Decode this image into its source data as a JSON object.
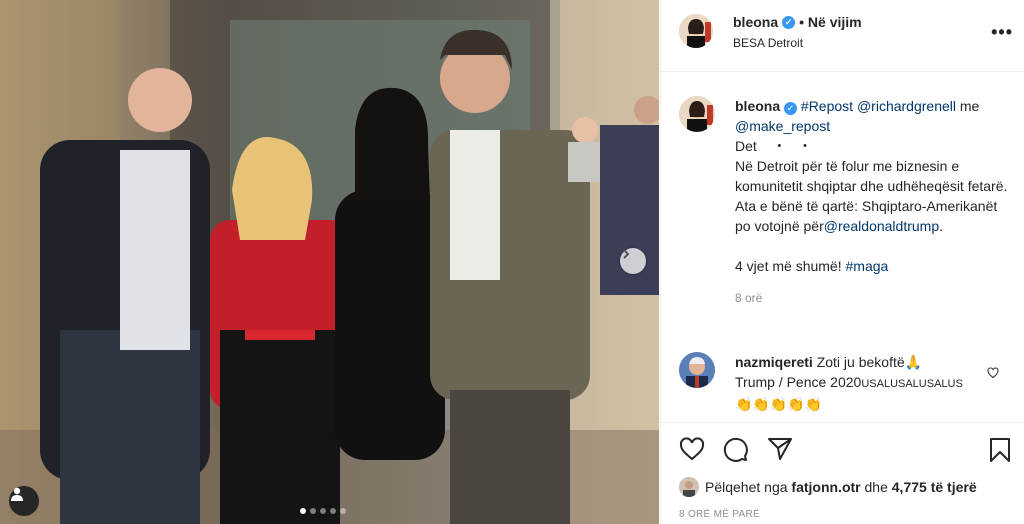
{
  "post": {
    "username": "bleona",
    "follow_label": "• Në vijim",
    "location": "BESA Detroit",
    "more_label": "•••"
  },
  "caption": {
    "username": "bleona",
    "repost_tag": "#Repost",
    "mention1": "@richardgrenell",
    "me": " me",
    "mention2": "@make_repost",
    "line_det": "Det    ・   ・",
    "body": "Në Detroit për të folur me biznesin e komunitetit shqiptar dhe udhëheqësit fetarë. Ata e bënë të qartë: Shqiptaro-Amerikanët po votojnë për",
    "mention3": "@realdonaldtrump",
    "period": ".",
    "closing": "4 vjet më shumë! ",
    "hashtag": "#maga",
    "time": "8 orë"
  },
  "comment": {
    "username": "nazmiqereti",
    "text": " Zoti ju bekoftë🙏",
    "line2": "Trump / Pence 2020",
    "suffix": "USALUSALUSALUS",
    "emojis": "👏👏👏👏👏"
  },
  "likes": {
    "prefix": "Pëlqehet nga ",
    "user": "fatjonn.otr",
    "middle": " dhe ",
    "count": "4,775 të tjerë"
  },
  "post_time": "8 ORË MË PARË",
  "carousel": {
    "count": 5,
    "active": 0
  },
  "colors": {
    "link": "#00376b",
    "verified": "#3897f0",
    "muted": "#8e8e8e",
    "border": "#efefef"
  },
  "icons": [
    "verified-icon",
    "more-icon",
    "heart-icon",
    "comment-icon",
    "share-icon",
    "bookmark-icon",
    "next-arrow-icon",
    "user-tag-icon"
  ]
}
